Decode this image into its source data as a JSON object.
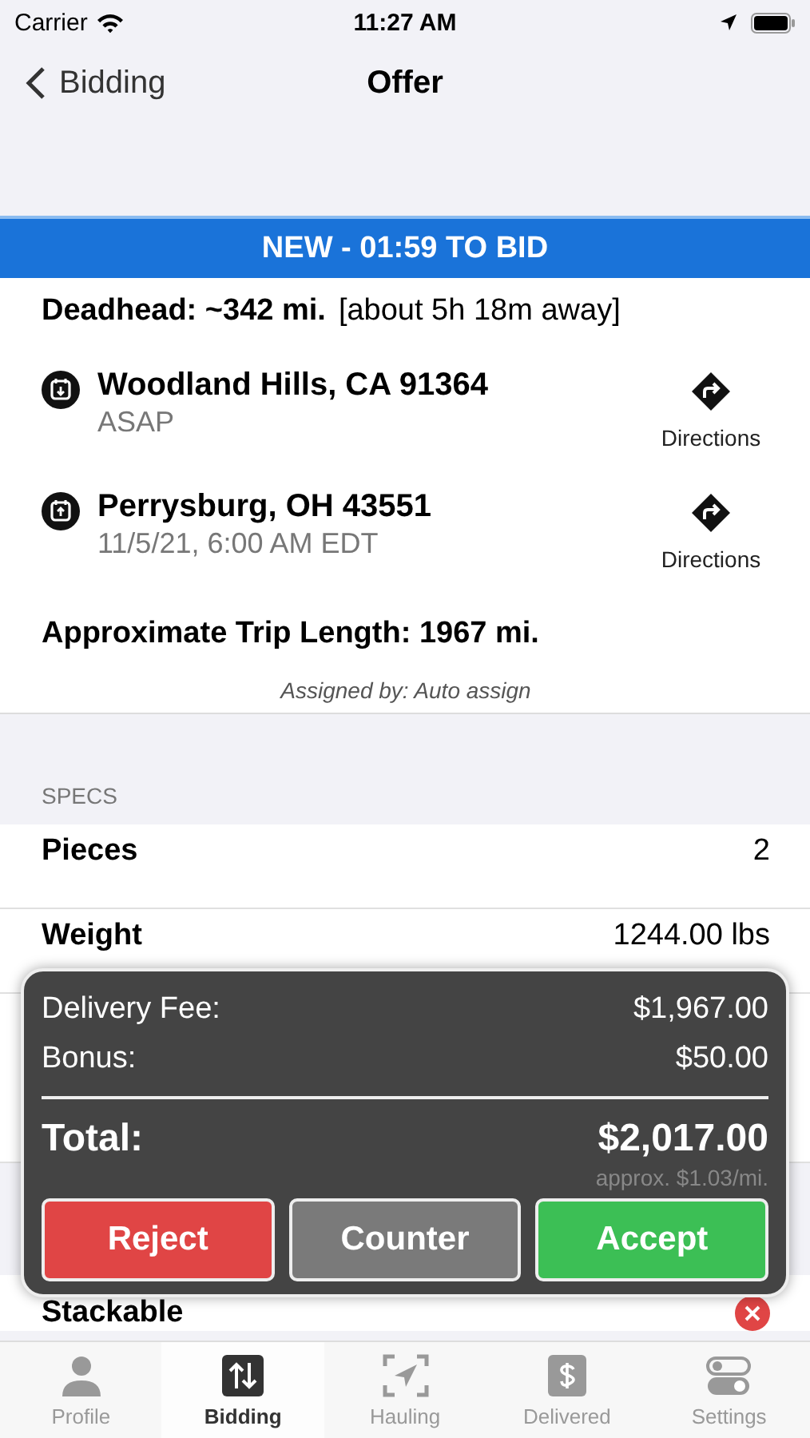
{
  "status_bar": {
    "carrier": "Carrier",
    "time": "11:27 AM"
  },
  "nav": {
    "back_label": "Bidding",
    "title": "Offer"
  },
  "banner": "NEW - 01:59 TO BID",
  "deadhead": {
    "label": "Deadhead: ~342 mi.",
    "detail": "[about 5h 18m away]"
  },
  "stops": [
    {
      "kind": "pickup",
      "place": "Woodland Hills, CA 91364",
      "time": "ASAP",
      "action": "Directions"
    },
    {
      "kind": "dropoff",
      "place": "Perrysburg, OH 43551",
      "time": "11/5/21, 6:00 AM EDT",
      "action": "Directions"
    }
  ],
  "trip_length": "Approximate Trip Length: 1967 mi.",
  "assigned_by": "Assigned by: Auto assign",
  "specs": {
    "header": "SPECS",
    "rows": [
      {
        "kind": "value",
        "label": "Pieces",
        "value": "2"
      },
      {
        "kind": "value",
        "label": "Weight",
        "value": "1244.00 lbs"
      },
      {
        "kind": "hidden"
      },
      {
        "kind": "flag",
        "label": "Stackable",
        "checked": false
      }
    ]
  },
  "offer": {
    "lines": [
      {
        "label": "Delivery Fee:",
        "amount": "$1,967.00"
      },
      {
        "label": "Bonus:",
        "amount": "$50.00"
      }
    ],
    "total_label": "Total:",
    "total": "$2,017.00",
    "rate": "approx. $1.03/mi.",
    "buttons": [
      {
        "kind": "reject",
        "label": "Reject"
      },
      {
        "kind": "counter",
        "label": "Counter"
      },
      {
        "kind": "accept",
        "label": "Accept"
      }
    ]
  },
  "tabs": [
    {
      "kind": "profile",
      "label": "Profile",
      "selected": false
    },
    {
      "kind": "bidding",
      "label": "Bidding",
      "selected": true
    },
    {
      "kind": "hauling",
      "label": "Hauling",
      "selected": false
    },
    {
      "kind": "delivered",
      "label": "Delivered",
      "selected": false
    },
    {
      "kind": "settings",
      "label": "Settings",
      "selected": false
    }
  ]
}
